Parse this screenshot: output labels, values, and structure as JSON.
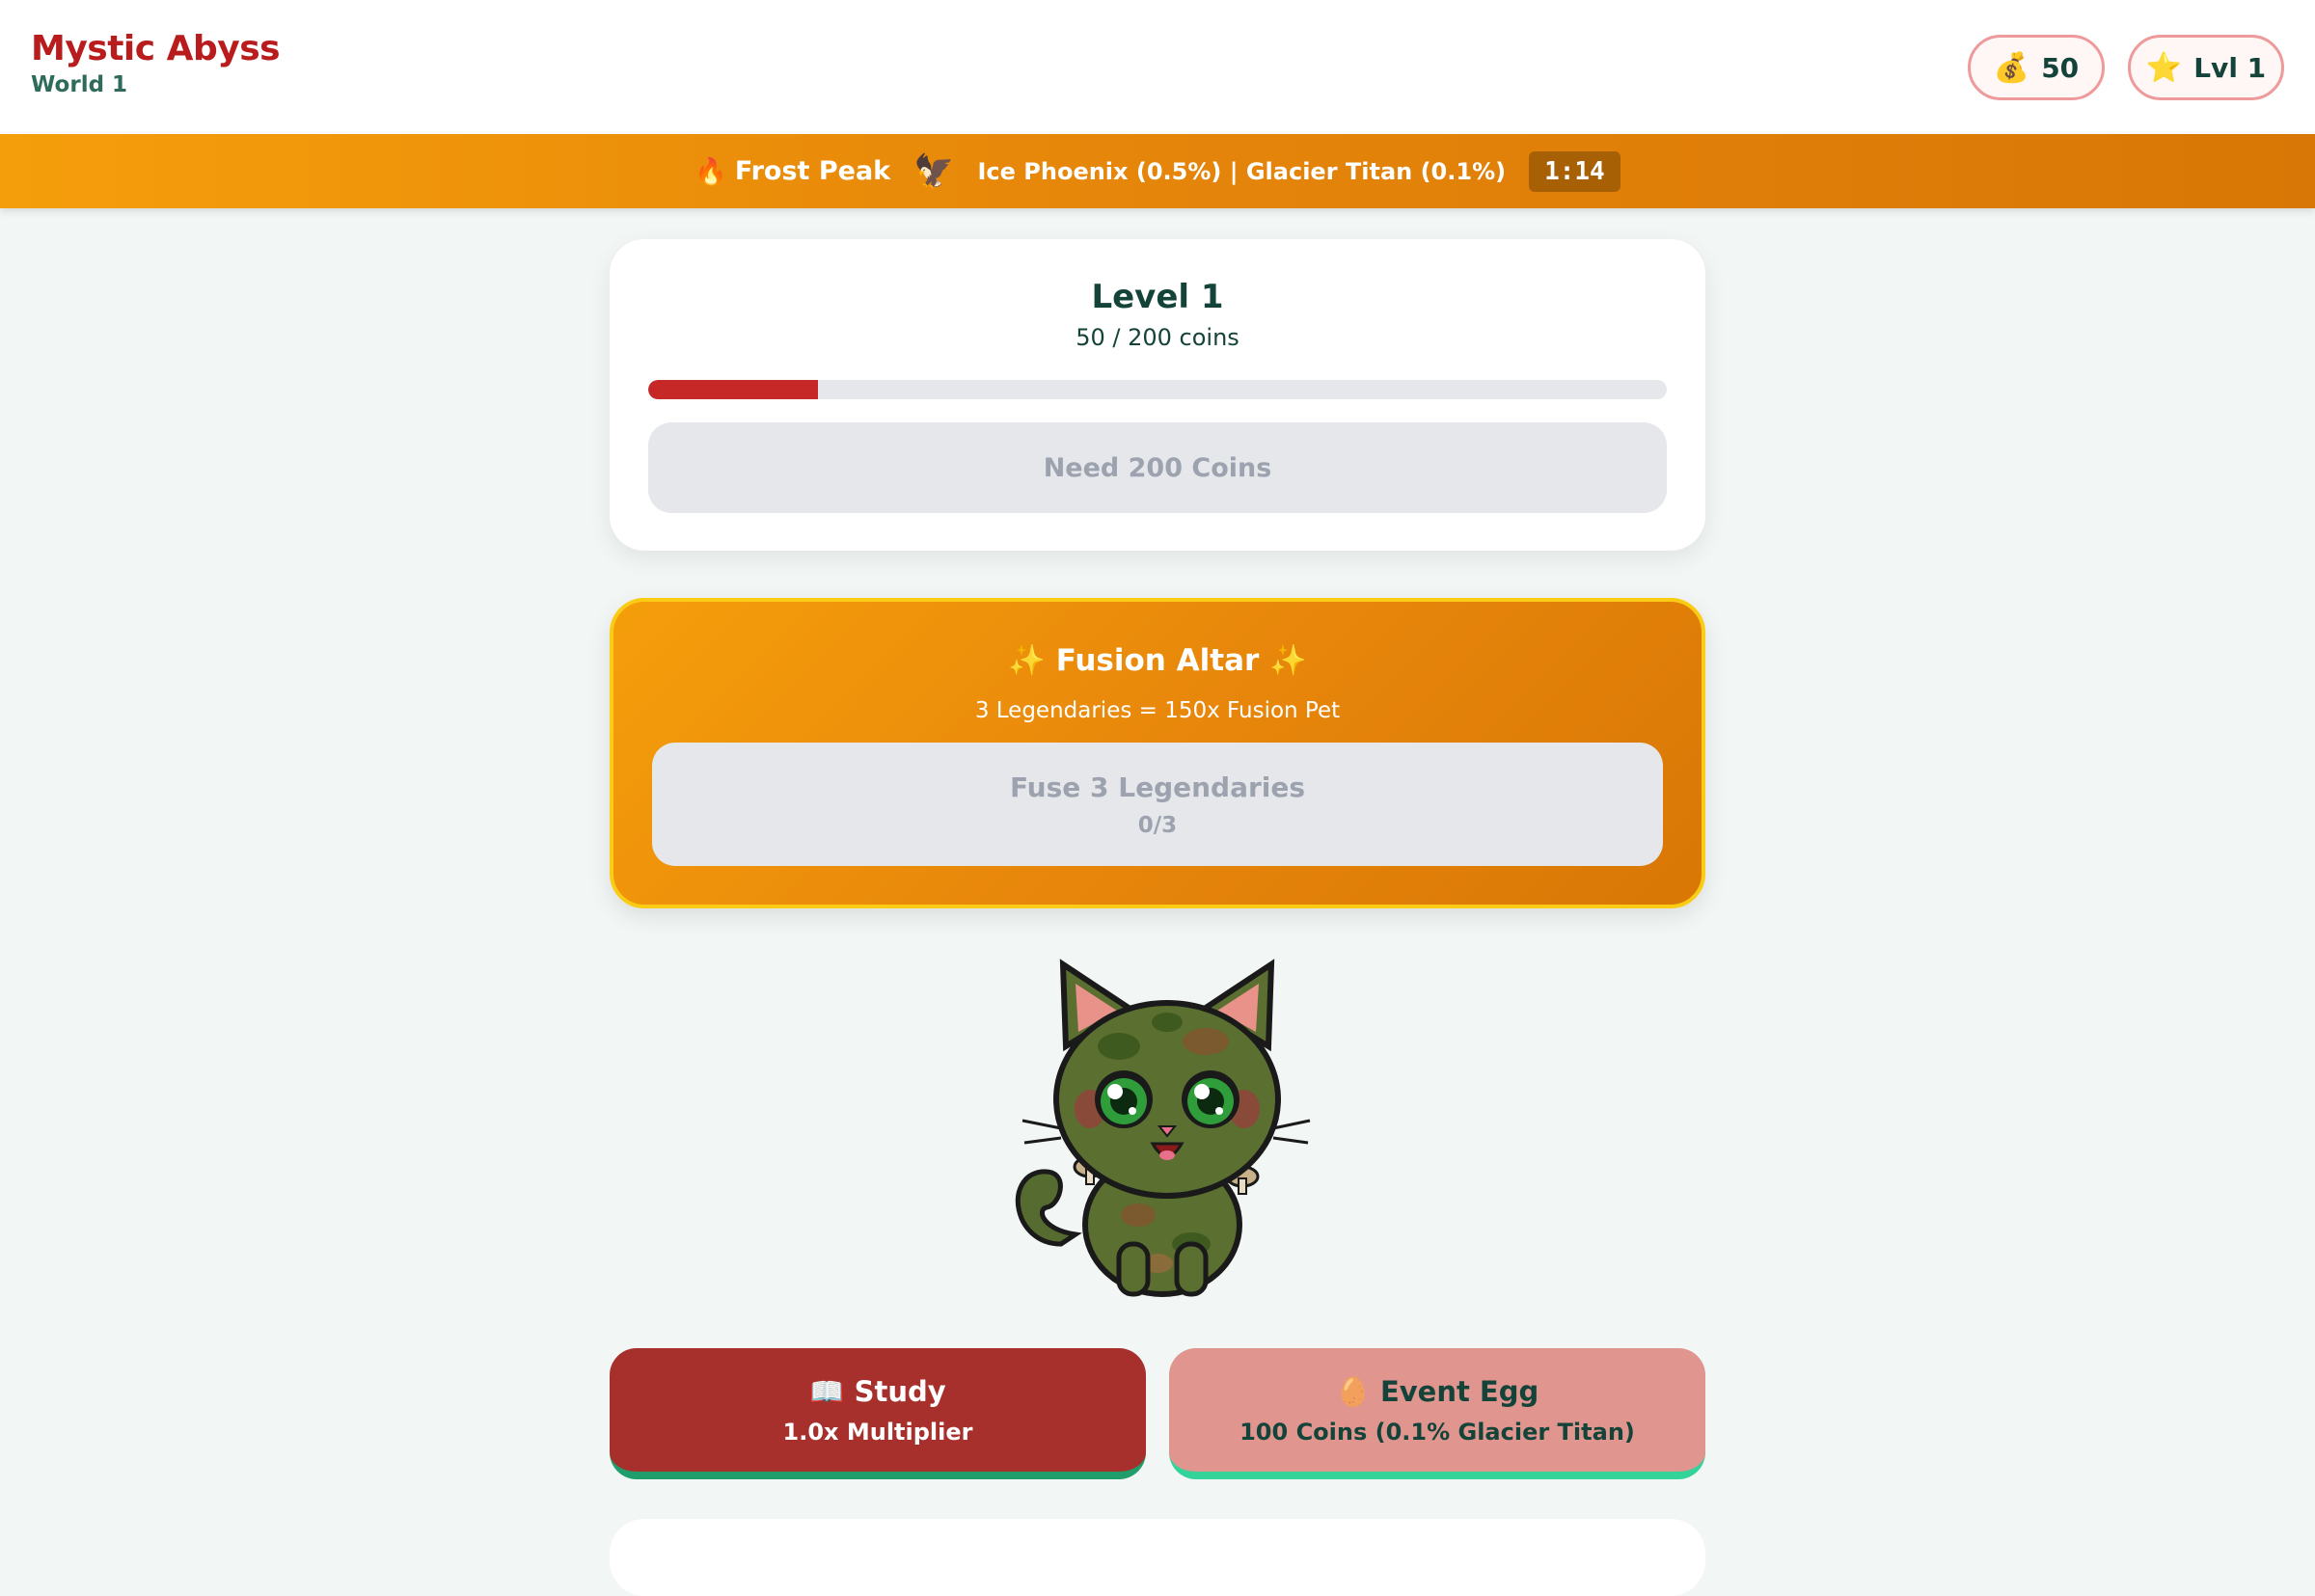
{
  "header": {
    "title": "Mystic Abyss",
    "subtitle": "World 1",
    "coins": {
      "icon": "money-bag-icon",
      "glyph": "💰",
      "value": "50"
    },
    "level": {
      "icon": "star-icon",
      "glyph": "⭐",
      "value": "Lvl 1"
    }
  },
  "event": {
    "fire_glyph": "🔥",
    "zone": "Frost Peak",
    "bird_glyph": "🦅",
    "drops": "Ice Phoenix (0.5%) | Glacier Titan (0.1%)",
    "timer": "1:14"
  },
  "level_card": {
    "title": "Level 1",
    "progress_text": "50 / 200 coins",
    "progress_fraction": 0.167,
    "button_label": "Need 200 Coins"
  },
  "fusion": {
    "spark": "✨",
    "title": "Fusion Altar",
    "subtitle": "3 Legendaries = 150x Fusion Pet",
    "button_label": "Fuse 3 Legendaries",
    "button_count": "0/3"
  },
  "actions": {
    "study": {
      "glyph": "📖",
      "label": "Study",
      "sub": "1.0x Multiplier"
    },
    "egg": {
      "glyph": "🥚",
      "label": "Event Egg",
      "sub": "100 Coins (0.1% Glacier Titan)"
    }
  },
  "colors": {
    "brand_red": "#b91c1c",
    "accent_orange": "#f59e0b",
    "altar_border": "#facc15",
    "study_bg": "#a8302c",
    "egg_bg": "#e0958f",
    "progress_fill": "#c62828"
  }
}
